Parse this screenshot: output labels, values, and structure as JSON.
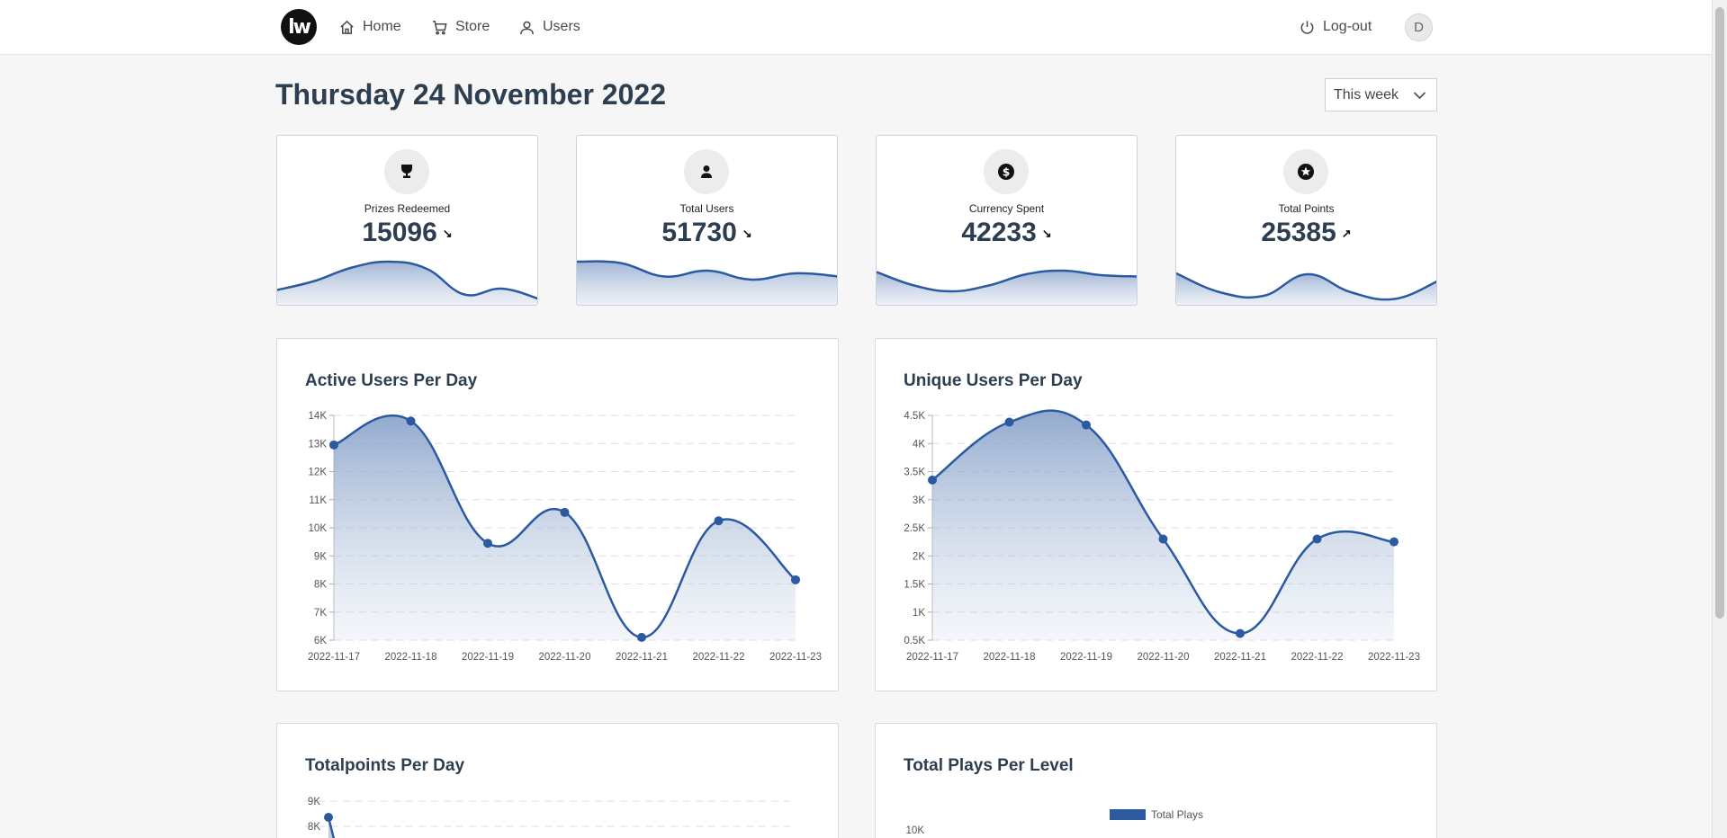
{
  "nav": {
    "logo_text": "lw",
    "items": [
      "Home",
      "Store",
      "Users"
    ],
    "logout": "Log-out",
    "avatar_initial": "D"
  },
  "header": {
    "date": "Thursday 24 November 2022",
    "range": "This week"
  },
  "stats": [
    {
      "label": "Prizes Redeemed",
      "value": "15096",
      "trend": "↘",
      "icon": "trophy-icon",
      "spark": [
        0.25,
        0.45,
        0.75,
        0.88,
        0.72,
        0.15,
        0.28,
        0.05
      ]
    },
    {
      "label": "Total Users",
      "value": "51730",
      "trend": "↘",
      "icon": "user-icon",
      "spark": [
        0.88,
        0.85,
        0.55,
        0.68,
        0.48,
        0.62,
        0.55
      ]
    },
    {
      "label": "Currency Spent",
      "value": "42233",
      "trend": "↘",
      "icon": "dollar-icon",
      "spark": [
        0.65,
        0.35,
        0.22,
        0.35,
        0.6,
        0.68,
        0.58,
        0.55
      ]
    },
    {
      "label": "Total Points",
      "value": "25385",
      "trend": "↗",
      "icon": "star-icon",
      "spark": [
        0.62,
        0.2,
        0.12,
        0.6,
        0.2,
        0.05,
        0.45
      ]
    }
  ],
  "colors": {
    "accent": "#2b5aa0",
    "card_border": "#cdd3da"
  },
  "chart_data": [
    {
      "type": "area",
      "title": "Active Users Per Day",
      "categories": [
        "2022-11-17",
        "2022-11-18",
        "2022-11-19",
        "2022-11-20",
        "2022-11-21",
        "2022-11-22",
        "2022-11-23"
      ],
      "values": [
        12950,
        13800,
        9450,
        10550,
        6100,
        10250,
        8150
      ],
      "ylim": [
        6000,
        14000
      ],
      "yticks": [
        "6K",
        "7K",
        "8K",
        "9K",
        "10K",
        "11K",
        "12K",
        "13K",
        "14K"
      ],
      "grid": true
    },
    {
      "type": "area",
      "title": "Unique Users Per Day",
      "categories": [
        "2022-11-17",
        "2022-11-18",
        "2022-11-19",
        "2022-11-20",
        "2022-11-21",
        "2022-11-22",
        "2022-11-23"
      ],
      "values": [
        3350,
        4380,
        4330,
        2300,
        620,
        2300,
        2250
      ],
      "ylim": [
        500,
        4500
      ],
      "yticks": [
        "0.5K",
        "1K",
        "1.5K",
        "2K",
        "2.5K",
        "3K",
        "3.5K",
        "4K",
        "4.5K"
      ],
      "grid": true
    },
    {
      "type": "area",
      "title": "Totalpoints Per Day",
      "values": [
        8350
      ],
      "yticks": [
        "9K",
        "8K"
      ],
      "grid": true
    },
    {
      "type": "bar",
      "title": "Total Plays Per Level",
      "legend": [
        "Total Plays"
      ],
      "yticks": [
        "10K"
      ],
      "legend_position": "top"
    }
  ]
}
